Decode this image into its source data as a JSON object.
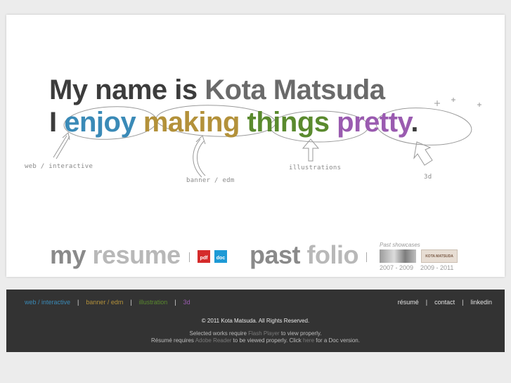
{
  "headline": {
    "line1_a": "My name is",
    "line1_b": "Kota Matsuda",
    "line2_i": "I",
    "w1": "enjoy",
    "w2": "making",
    "w3": "things",
    "w4": "pretty",
    "period": "."
  },
  "sketch_labels": {
    "web": "web / interactive",
    "banner": "banner / edm",
    "illus": "illustrations",
    "three_d": "3d"
  },
  "links": {
    "resume_a": "my",
    "resume_b": "resume",
    "pdf": "pdf",
    "doc": "doc",
    "folio_a": "past",
    "folio_b": "folio"
  },
  "showcase": {
    "title": "Past showcases",
    "thumb2_text": "KOTA MATSUDA",
    "cap1": "2007 - 2009",
    "cap2": "2009 - 2011"
  },
  "footer": {
    "nav_left": [
      {
        "label": "web / interactive",
        "color": "#3a8ab7"
      },
      {
        "label": "banner / edm",
        "color": "#b3913a"
      },
      {
        "label": "illustration",
        "color": "#5a8a2e"
      },
      {
        "label": "3d",
        "color": "#9a5bb0"
      }
    ],
    "nav_right": [
      "résumé",
      "contact",
      "linkedin"
    ],
    "copyright": "© 2011 Kota Matsuda. All Rights Reserved.",
    "note1_a": "Selected works require",
    "note1_link": "Flash Player",
    "note1_b": "to view properly.",
    "note2_a": "Résumé requires",
    "note2_link": "Adobe Reader",
    "note2_b": "to be viewed properly. Click",
    "note2_link2": "here",
    "note2_c": "for a Doc version."
  },
  "colors": {
    "enjoy": "#3a8ab7",
    "making": "#b3913a",
    "things": "#5a8a2e",
    "pretty": "#9a5bb0",
    "footer_bg": "#333333"
  }
}
